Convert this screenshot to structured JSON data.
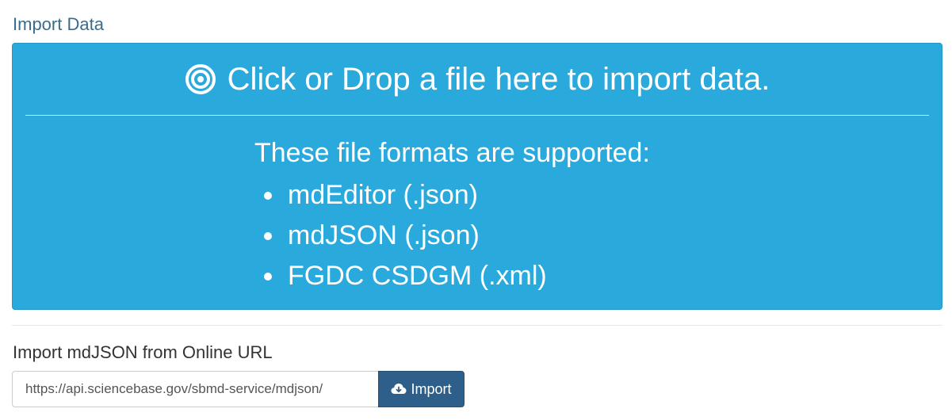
{
  "page": {
    "title": "Import Data"
  },
  "dropzone": {
    "icon": "bullseye-icon",
    "heading": "Click or Drop a file here to import data.",
    "formats_title": "These file formats are supported:",
    "formats": [
      "mdEditor (.json)",
      "mdJSON (.json)",
      "FGDC CSDGM (.xml)"
    ]
  },
  "url_import": {
    "label": "Import mdJSON from Online URL",
    "value": "https://api.sciencebase.gov/sbmd-service/mdjson/",
    "button_label": "Import",
    "button_icon": "cloud-download-icon"
  },
  "colors": {
    "title": "#3a6d8c",
    "dropzone_bg": "#2aa9dd",
    "button_bg": "#2e5f8a"
  }
}
